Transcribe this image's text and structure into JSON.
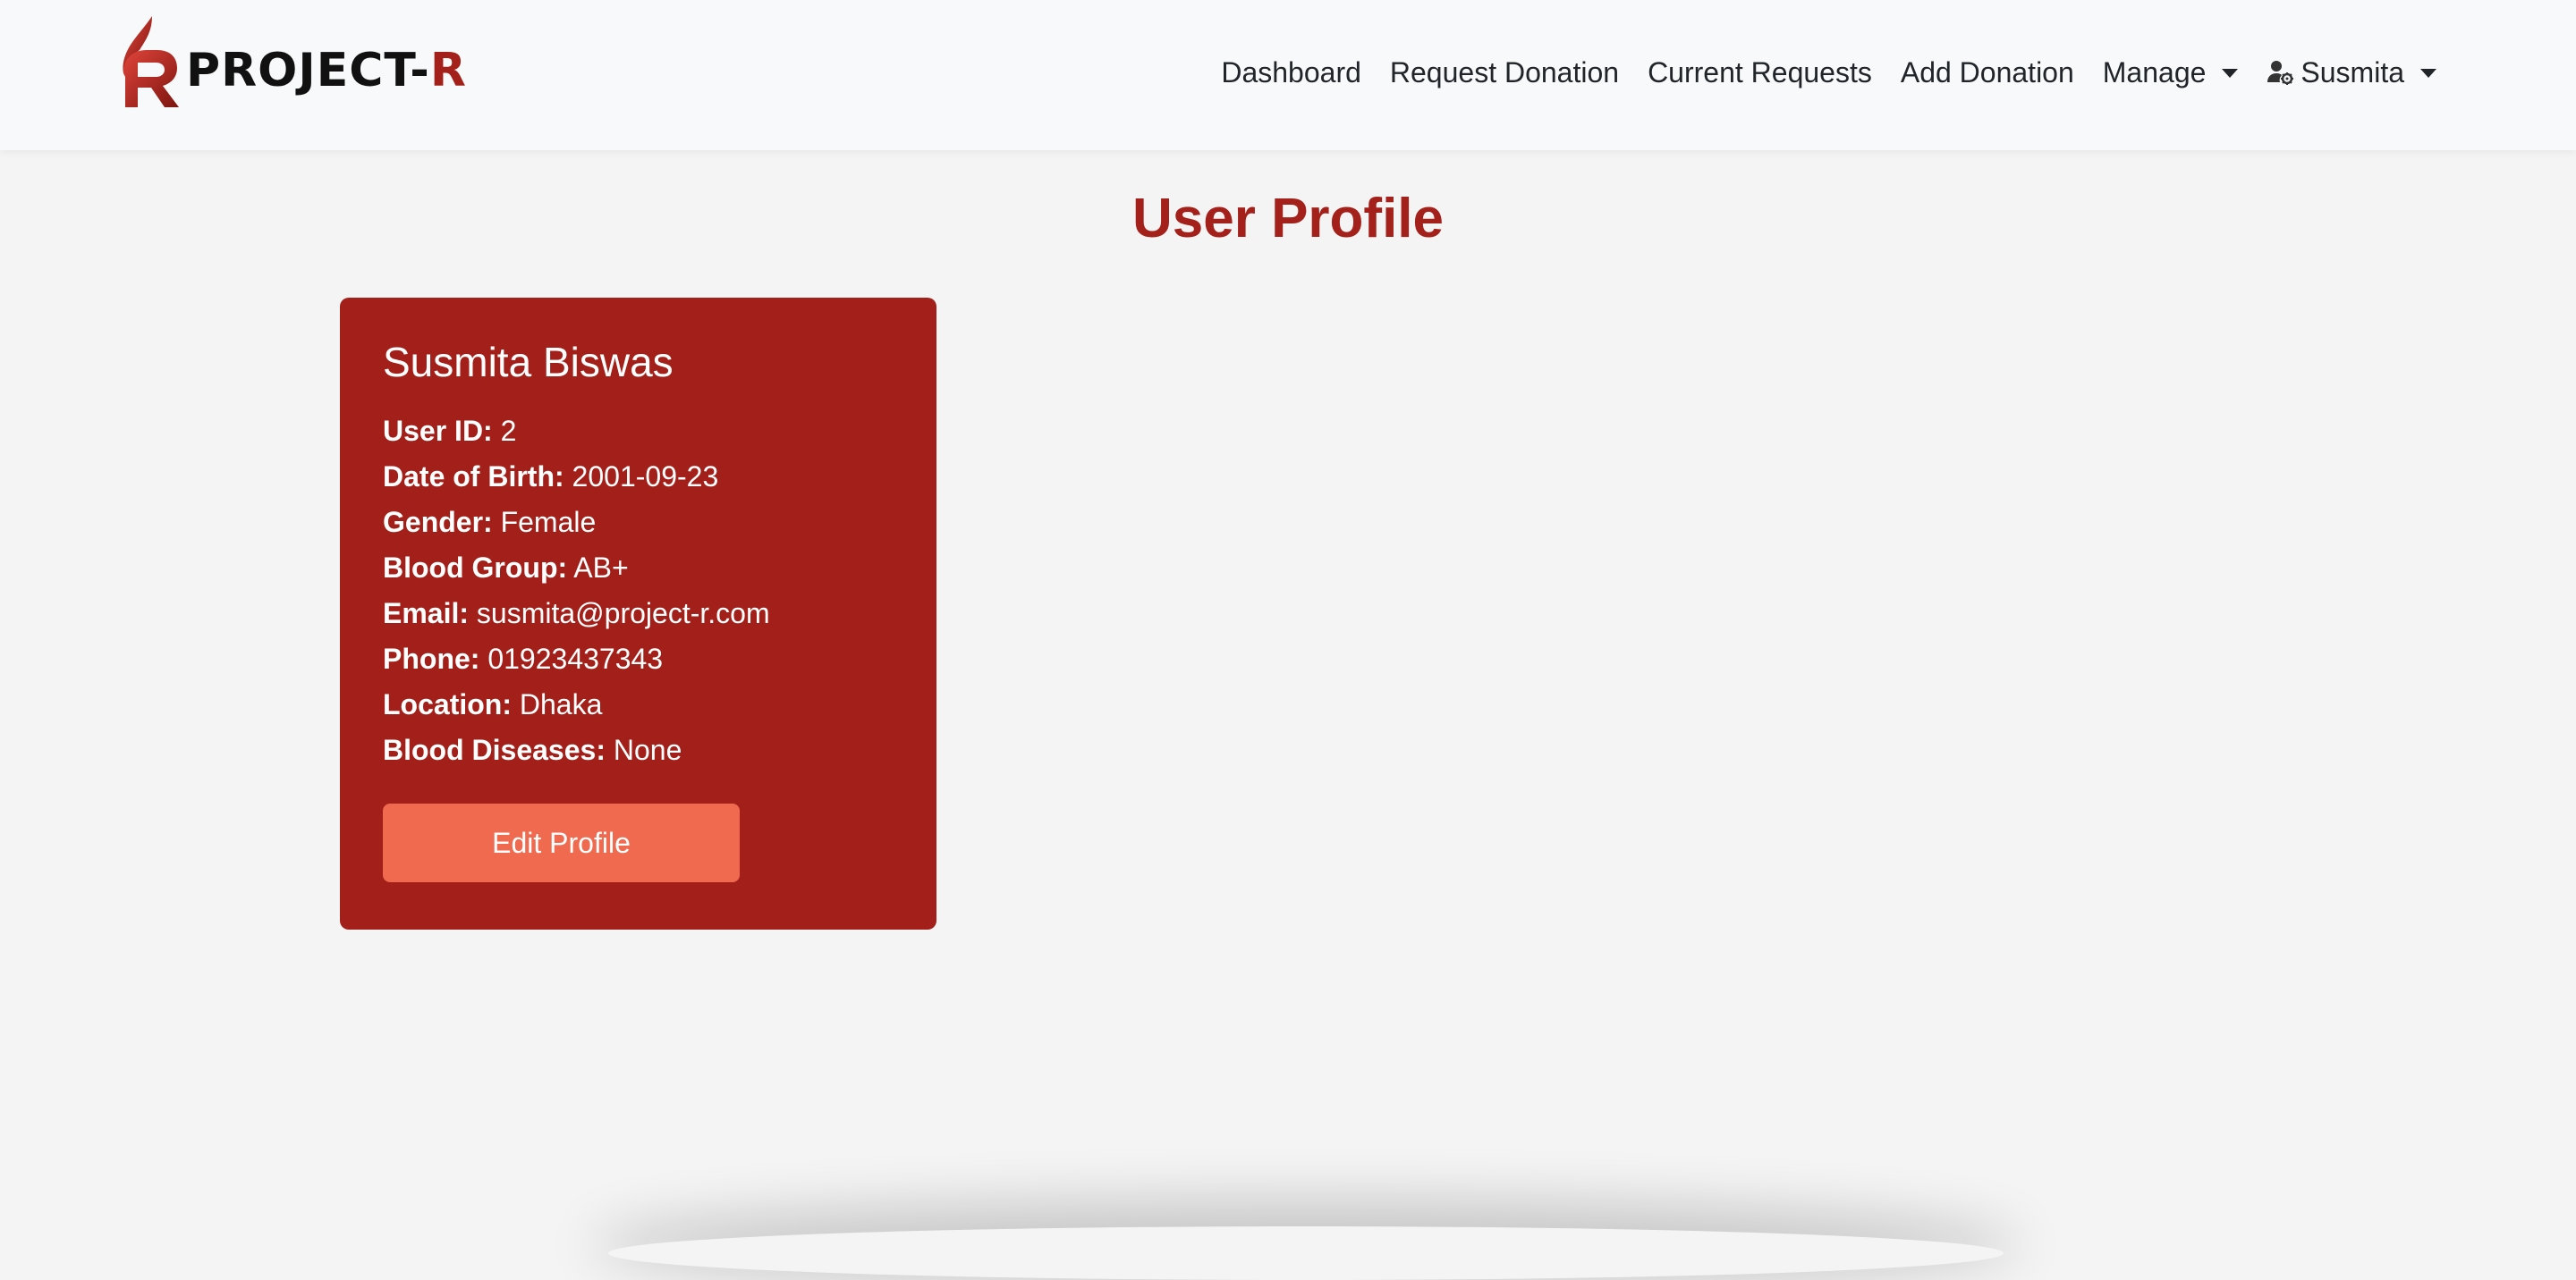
{
  "brand": {
    "name_main": "PROJECT-",
    "name_accent": "R",
    "logo_icon": "flame-r-logo-icon",
    "accent_color": "#a3211a"
  },
  "nav": {
    "items": [
      {
        "label": "Dashboard"
      },
      {
        "label": "Request Donation"
      },
      {
        "label": "Current Requests"
      },
      {
        "label": "Add Donation"
      },
      {
        "label": "Manage",
        "dropdown": true
      }
    ],
    "user": {
      "label": "Susmita",
      "icon": "user-gear-icon",
      "dropdown": true
    }
  },
  "page": {
    "title": "User Profile",
    "title_color": "#a3211a"
  },
  "profile": {
    "name": "Susmita Biswas",
    "card_color": "#a3201a",
    "fields": [
      {
        "label": "User ID:",
        "value": "2"
      },
      {
        "label": "Date of Birth:",
        "value": "2001-09-23"
      },
      {
        "label": "Gender:",
        "value": "Female"
      },
      {
        "label": "Blood Group:",
        "value": "AB+"
      },
      {
        "label": "Email:",
        "value": "susmita@project-r.com"
      },
      {
        "label": "Phone:",
        "value": "01923437343"
      },
      {
        "label": "Location:",
        "value": "Dhaka"
      },
      {
        "label": "Blood Diseases:",
        "value": "None"
      }
    ],
    "edit_button_label": "Edit Profile",
    "edit_button_color": "#ef6a4e"
  }
}
